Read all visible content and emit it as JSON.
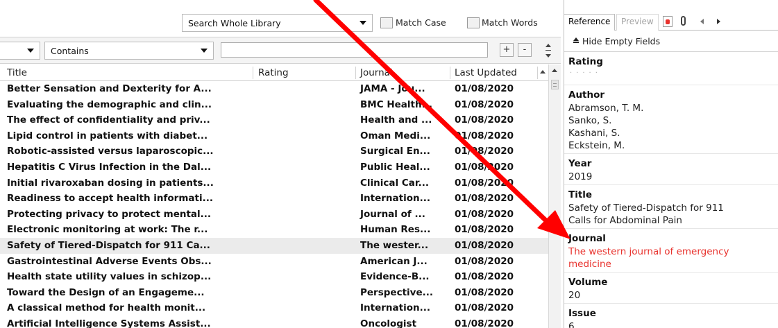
{
  "toolbar": {
    "search_scope": "Search Whole Library",
    "match_case": "Match Case",
    "match_words": "Match Words"
  },
  "search": {
    "operator": "Contains",
    "plus": "+",
    "minus": "-"
  },
  "table": {
    "headers": [
      "Title",
      "Rating",
      "Journal",
      "Last Updated"
    ],
    "rows": [
      {
        "title": "Better Sensation and Dexterity for A...",
        "journal": "JAMA - Jou...",
        "updated": "01/08/2020"
      },
      {
        "title": "Evaluating the demographic and clin...",
        "journal": "BMC Health...",
        "updated": "01/08/2020"
      },
      {
        "title": "The effect of confidentiality and priv...",
        "journal": "Health and ...",
        "updated": "01/08/2020"
      },
      {
        "title": "Lipid control in patients with diabet...",
        "journal": "Oman Medi...",
        "updated": "01/08/2020"
      },
      {
        "title": "Robotic-assisted versus laparoscopic...",
        "journal": "Surgical En...",
        "updated": "01/08/2020"
      },
      {
        "title": "Hepatitis C Virus Infection in the Dal...",
        "journal": "Public Heal...",
        "updated": "01/08/2020"
      },
      {
        "title": "Initial rivaroxaban dosing in patients...",
        "journal": "Clinical Car...",
        "updated": "01/08/2020"
      },
      {
        "title": "Readiness to accept health informati...",
        "journal": "Internation...",
        "updated": "01/08/2020"
      },
      {
        "title": "Protecting privacy to protect mental...",
        "journal": "Journal of ...",
        "updated": "01/08/2020"
      },
      {
        "title": "Electronic monitoring at work: The r...",
        "journal": "Human Res...",
        "updated": "01/08/2020"
      },
      {
        "title": "Safety of Tiered-Dispatch for 911 Ca...",
        "journal": "The wester...",
        "updated": "01/08/2020",
        "selected": true
      },
      {
        "title": "Gastrointestinal Adverse Events Obs...",
        "journal": "American J...",
        "updated": "01/08/2020"
      },
      {
        "title": "Health state utility values in schizop...",
        "journal": "Evidence-B...",
        "updated": "01/08/2020"
      },
      {
        "title": "Toward the Design of an Engageme...",
        "journal": "Perspective...",
        "updated": "01/08/2020"
      },
      {
        "title": "A classical method for health monit...",
        "journal": "Internation...",
        "updated": "01/08/2020"
      },
      {
        "title": "Artificial Intelligence Systems Assist...",
        "journal": "Oncologist",
        "updated": "01/08/2020"
      }
    ]
  },
  "panel": {
    "tabs": {
      "reference": "Reference",
      "preview": "Preview"
    },
    "icons": {
      "pdf": "pdf-icon",
      "attach": "paperclip-icon",
      "prev": "chevron-left-icon",
      "next": "chevron-right-icon"
    },
    "hide_empty": "Hide Empty Fields",
    "fields": {
      "rating_label": "Rating",
      "author_label": "Author",
      "authors": [
        "Abramson, T. M.",
        "Sanko, S.",
        "Kashani, S.",
        "Eckstein, M."
      ],
      "year_label": "Year",
      "year": "2019",
      "title_label": "Title",
      "title_lines": [
        "Safety of Tiered-Dispatch for 911",
        "Calls for Abdominal Pain"
      ],
      "journal_label": "Journal",
      "journal_lines": [
        "The western journal of emergency",
        "medicine"
      ],
      "volume_label": "Volume",
      "volume": "20",
      "issue_label": "Issue",
      "issue": "6"
    }
  },
  "colors": {
    "accent_arrow": "#ff0000",
    "journal_text": "#e8322d",
    "selected_row": "#ebebeb"
  }
}
